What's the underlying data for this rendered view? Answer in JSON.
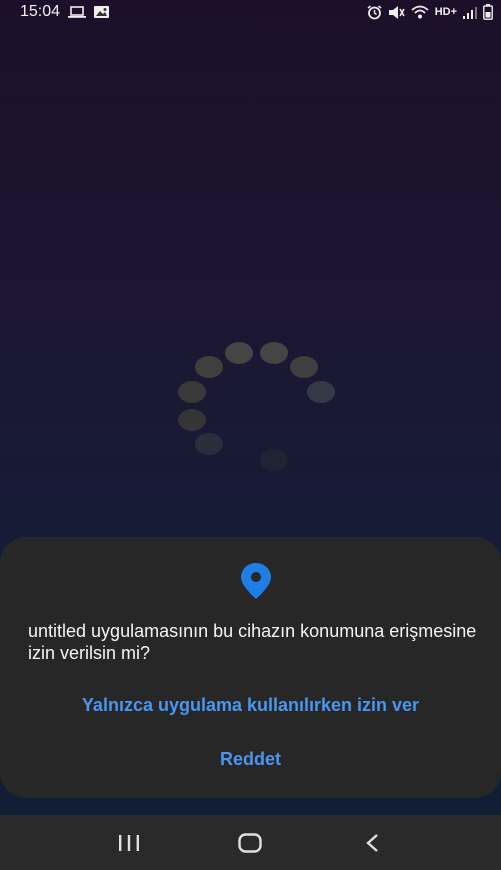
{
  "status_bar": {
    "time": "15:04",
    "network_label": "HD+",
    "icons": [
      "laptop-icon",
      "image-icon",
      "alarm-icon",
      "mute-icon",
      "wifi-icon",
      "signal-icon",
      "battery-icon"
    ]
  },
  "spinner": {
    "state": "loading"
  },
  "permission_dialog": {
    "icon": "location-pin-icon",
    "message": "untitled uygulamasının bu cihazın konumuna erişmesine izin verilsin mi?",
    "allow_button": "Yalnızca uygulama kullanılırken izin ver",
    "deny_button": "Reddet",
    "accent_color": "#4a95f0"
  },
  "nav_bar": {
    "buttons": [
      "recent-apps-icon",
      "home-icon",
      "back-icon"
    ]
  }
}
